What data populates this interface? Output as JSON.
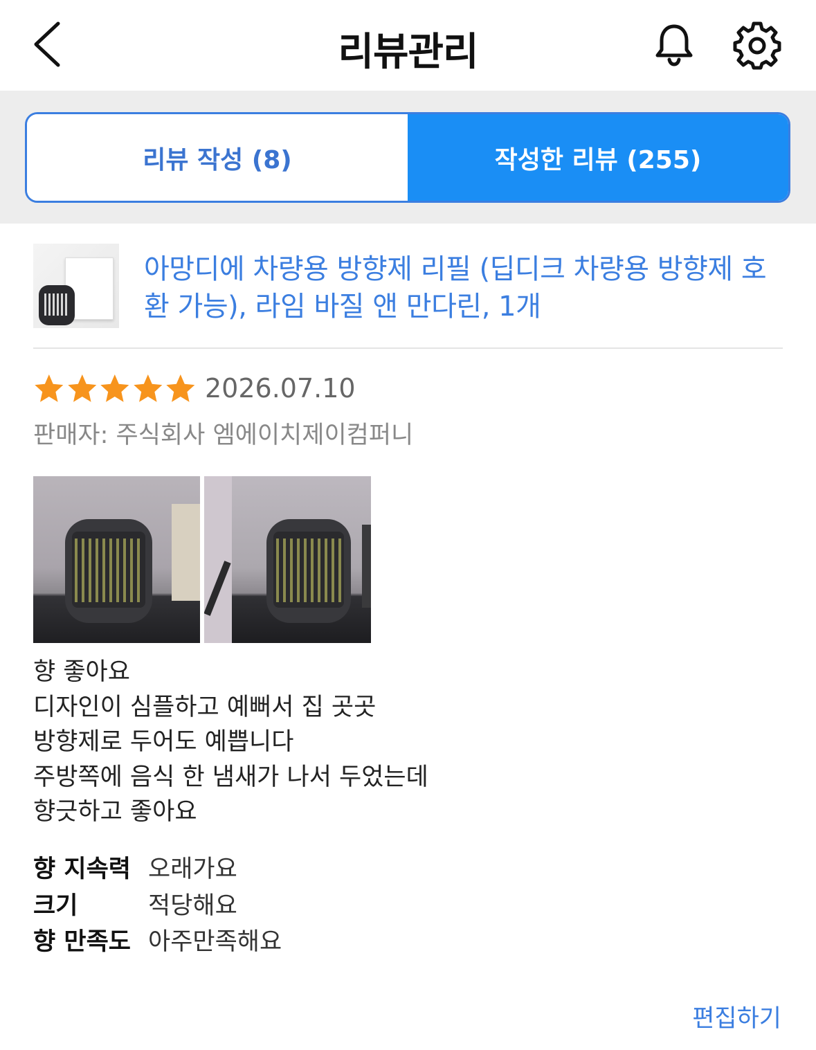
{
  "header": {
    "title": "리뷰관리",
    "icons": {
      "back": "chevron-left-icon",
      "notifications": "bell-icon",
      "settings": "gear-icon"
    }
  },
  "tabs": [
    {
      "label": "리뷰 작성 (8)",
      "active": false
    },
    {
      "label": "작성한 리뷰 (255)",
      "active": true
    }
  ],
  "colors": {
    "accent": "#3b7ee0",
    "active_tab": "#1a8ef5",
    "star": "#f7941d",
    "tabs_background": "#ededed"
  },
  "review": {
    "product_name": "아망디에 차량용 방향제 리필 (딥디크 차량용 방향제 호환 가능), 라임 바질 앤 만다린, 1개",
    "rating": 5,
    "rating_max": 5,
    "date": "2026.07.10",
    "seller": "판매자: 주식회사 엠에이치제이컴퍼니",
    "photo_count": 2,
    "text": "향 좋아요\n디자인이 심플하고 예뻐서 집 곳곳\n방향제로 두어도 예쁩니다\n주방쪽에 음식 한 냄새가 나서 두었는데\n향긋하고 좋아요",
    "attributes": [
      {
        "label": "향 지속력",
        "value": "오래가요"
      },
      {
        "label": "크기",
        "value": "적당해요"
      },
      {
        "label": "향 만족도",
        "value": "아주만족해요"
      }
    ],
    "edit_label": "편집하기"
  }
}
